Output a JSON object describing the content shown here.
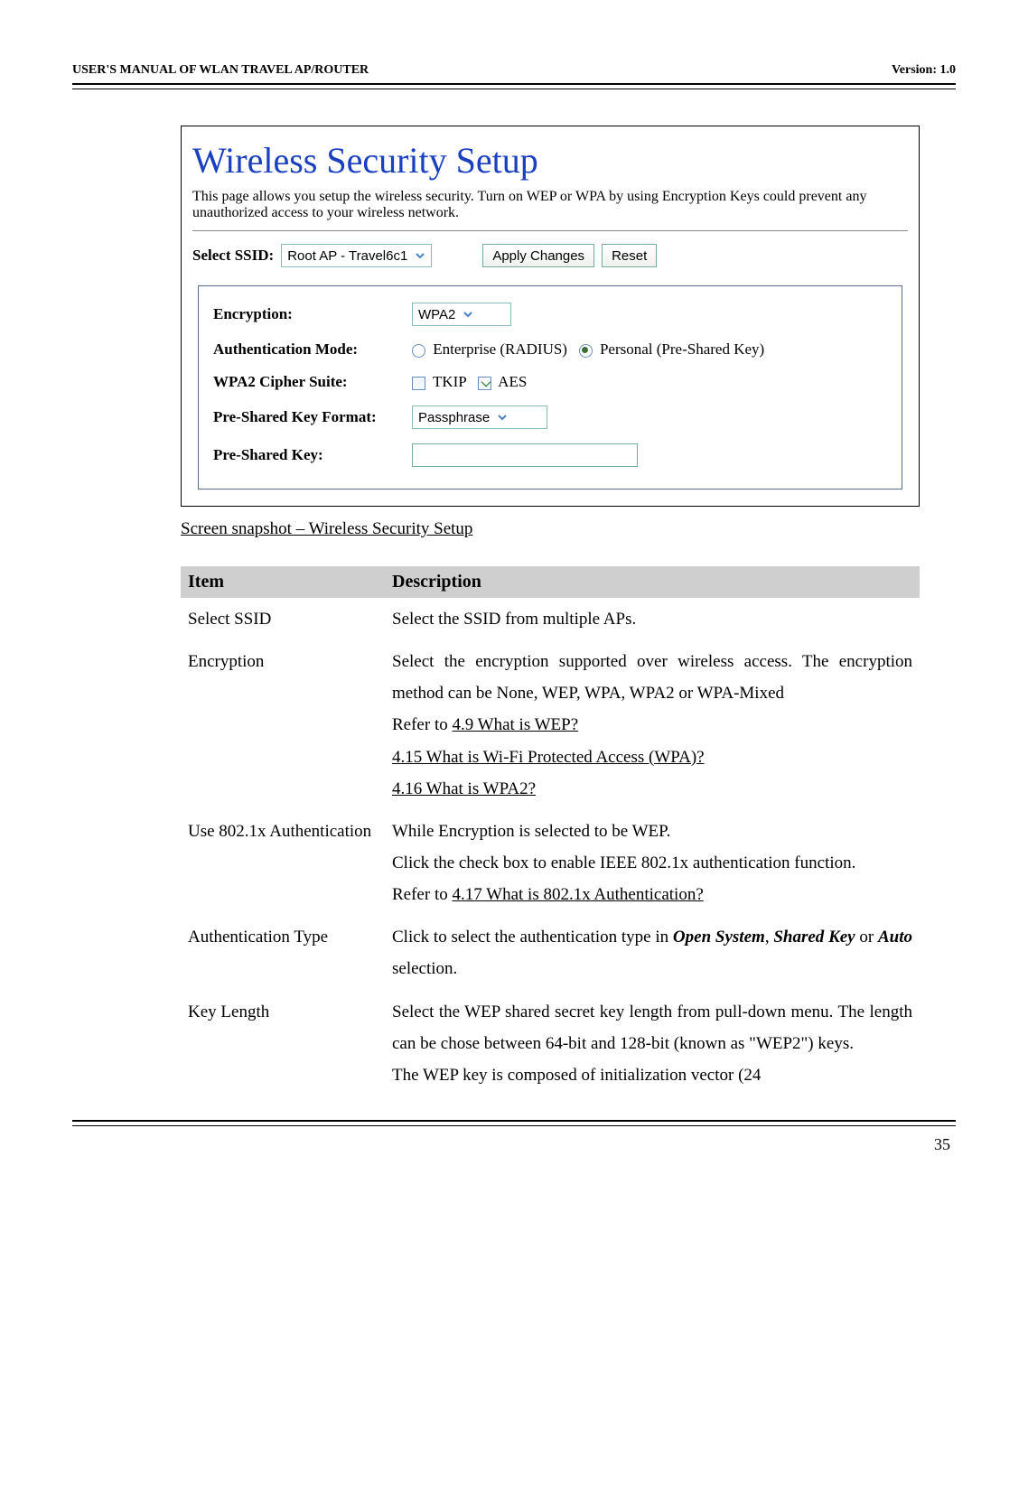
{
  "header": {
    "left": "USER'S MANUAL OF WLAN TRAVEL AP/ROUTER",
    "right": "Version: 1.0"
  },
  "panel": {
    "title": "Wireless Security Setup",
    "description": "This page allows you setup the wireless security. Turn on WEP or WPA by using Encryption Keys could prevent any unauthorized access to your wireless network.",
    "select_ssid_label": "Select SSID:",
    "ssid_value": "Root AP - Travel6c1",
    "apply_btn": "Apply Changes",
    "reset_btn": "Reset",
    "fields": {
      "encryption_label": "Encryption:",
      "encryption_value": "WPA2",
      "auth_mode_label": "Authentication Mode:",
      "auth_enterprise": "Enterprise (RADIUS)",
      "auth_personal": "Personal (Pre-Shared Key)",
      "cipher_label": "WPA2 Cipher Suite:",
      "cipher_tkip": "TKIP",
      "cipher_aes": "AES",
      "psk_format_label": "Pre-Shared Key Format:",
      "psk_format_value": "Passphrase",
      "psk_key_label": "Pre-Shared Key:",
      "psk_key_value": ""
    }
  },
  "caption": "Screen snapshot – Wireless Security Setup",
  "table": {
    "headers": {
      "item": "Item",
      "desc": "Description"
    },
    "rows": [
      {
        "item": "Select SSID",
        "desc_plain": "Select the SSID from multiple APs."
      },
      {
        "item": "Encryption",
        "desc_lines": [
          "Select the encryption supported over wireless access. The encryption method can be None, WEP, WPA, WPA2 or WPA-Mixed",
          "Refer to "
        ],
        "links": [
          "4.9 What is WEP?",
          "4.15 What is Wi-Fi Protected Access (WPA)?",
          "4.16 What is WPA2?"
        ]
      },
      {
        "item": "Use 802.1x Authentication",
        "desc_lines": [
          "While Encryption is selected to be WEP.",
          "Click the check box to enable IEEE 802.1x authentication function.",
          "Refer to "
        ],
        "links": [
          "4.17 What is 802.1x Authentication?"
        ]
      },
      {
        "item": "Authentication Type",
        "desc_pre": "Click to select the authentication type in ",
        "opt1": "Open System",
        "mid": ", ",
        "opt2": "Shared Key",
        "or": " or ",
        "opt3": "Auto",
        "desc_post": " selection."
      },
      {
        "item": "Key Length",
        "desc_plain": "Select the WEP shared secret key length from pull-down menu. The length can be chose between 64-bit and 128-bit (known as \"WEP2\") keys.",
        "desc_extra": "The WEP key is composed of initialization vector (24"
      }
    ]
  },
  "footer": {
    "page": "35"
  }
}
